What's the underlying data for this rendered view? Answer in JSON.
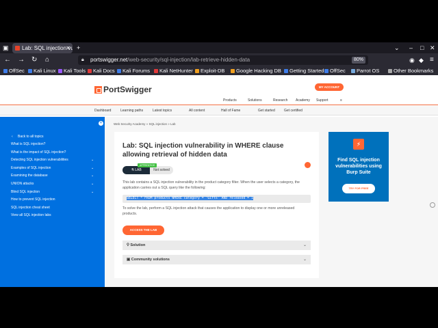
{
  "browser": {
    "tab_title": "Lab: SQL injection vulnerabi",
    "url_domain": "portswigger.net",
    "url_path": "/web-security/sql-injection/lab-retrieve-hidden-data",
    "zoom": "80%",
    "bookmarks": [
      {
        "label": "OffSec",
        "color": "#3f7de8"
      },
      {
        "label": "Kali Linux",
        "color": "#3f7de8"
      },
      {
        "label": "Kali Tools",
        "color": "#9b59ff"
      },
      {
        "label": "Kali Docs",
        "color": "#e03a3a"
      },
      {
        "label": "Kali Forums",
        "color": "#3f7de8"
      },
      {
        "label": "Kali NetHunter",
        "color": "#e03a3a"
      },
      {
        "label": "Exploit-DB",
        "color": "#f0a020"
      },
      {
        "label": "Google Hacking DB",
        "color": "#f0a020"
      },
      {
        "label": "Getting Started",
        "color": "#3f7de8"
      },
      {
        "label": "OffSec",
        "color": "#3f7de8"
      },
      {
        "label": "Parrot OS",
        "color": "#7ad"
      },
      {
        "label": "Other Bookmarks",
        "color": "#aaa"
      }
    ]
  },
  "header": {
    "logo_text": "PortSwigger",
    "my_account": "MY ACCOUNT",
    "topnav": [
      "Products",
      "Solutions",
      "Research",
      "Academy",
      "Support"
    ]
  },
  "subnav": [
    "Dashboard",
    "Learning paths",
    "Latest topics",
    "All content",
    "Hall of Fame",
    "Get started",
    "Get certified"
  ],
  "sidebar": {
    "items": [
      {
        "label": "Back to all topics",
        "chevron": false
      },
      {
        "label": "What is SQL injection?",
        "chevron": false
      },
      {
        "label": "What is the impact of SQL injection?",
        "chevron": false
      },
      {
        "label": "Detecting SQL injection vulnerabilities",
        "chevron": true
      },
      {
        "label": "Examples of SQL injection",
        "chevron": true
      },
      {
        "label": "Examining the database",
        "chevron": true
      },
      {
        "label": "UNION attacks",
        "chevron": true
      },
      {
        "label": "Blind SQL injection",
        "chevron": true
      },
      {
        "label": "How to prevent SQL injection",
        "chevron": false
      },
      {
        "label": "SQL injection cheat sheet",
        "chevron": false
      },
      {
        "label": "View all SQL injection labs",
        "chevron": false
      }
    ]
  },
  "main": {
    "breadcrumb": "Web Security Academy  »  SQL injection  »  Lab",
    "title": "Lab: SQL injection vulnerability in WHERE clause allowing retrieval of hidden data",
    "badge_level": "APPRENTICE",
    "badge_lab": "LAB",
    "badge_status": "Not solved",
    "intro": "This lab contains a SQL injection vulnerability in the product category filter. When the user selects a category, the application carries out a SQL query like the following:",
    "sql": "SELECT * FROM products WHERE category = 'Gifts' AND released = 1",
    "solve": "To solve the lab, perform a SQL injection attack that causes the application to display one or more unreleased products.",
    "access_button": "ACCESS THE LAB",
    "accordions": [
      "Solution",
      "Community solutions"
    ]
  },
  "ad": {
    "text": "Find SQL injection vulnerabilities using Burp Suite",
    "button": "TRY FOR FREE"
  }
}
